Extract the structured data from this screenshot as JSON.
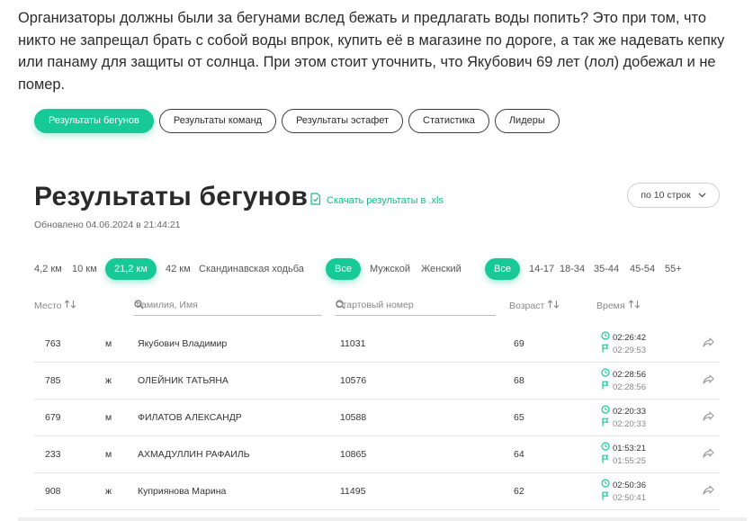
{
  "intro_text": "Организаторы должны были за бегунами вслед бежать и предлагать воды попить? Это при том, что никто не запрещал брать с собой воды впрок, купить её в магазине по дороге, а так же надевать кепку или панаму для защиты от солнца. При этом стоит уточнить, что Якубович 69 лет (лол) добежал и не помер.",
  "tabs": [
    {
      "label": "Результаты бегунов",
      "active": true
    },
    {
      "label": "Результаты команд",
      "active": false
    },
    {
      "label": "Результаты эстафет",
      "active": false
    },
    {
      "label": "Статистика",
      "active": false
    },
    {
      "label": "Лидеры",
      "active": false
    }
  ],
  "page_title": "Результаты бегунов",
  "download_label": "Скачать результаты в .xls",
  "updated_label": "Обновлено 04.06.2024 в 21:44:21",
  "per_page": {
    "label": "по 10 строк"
  },
  "distance_filters": [
    "4,2 км",
    "10 км",
    "21,2 км",
    "42 км",
    "Скандинавская ходьба"
  ],
  "distance_selected": "21,2 км",
  "gender_filters": [
    "Все",
    "Мужской",
    "Женский"
  ],
  "gender_selected": "Все",
  "age_filters": [
    "Все",
    "14-17",
    "18-34",
    "35-44",
    "45-54",
    "55+"
  ],
  "age_selected": "Все",
  "columns": {
    "place": "Место",
    "name_placeholder": "Фамилия, Имя",
    "number_placeholder": "Стартовый номер",
    "age": "Возраст",
    "time": "Время"
  },
  "rows": [
    {
      "place": "763",
      "gender": "м",
      "name": "Якубович Владимир",
      "number": "11031",
      "age": "69",
      "chip_time": "02:26:42",
      "finish_time": "02:29:53"
    },
    {
      "place": "785",
      "gender": "ж",
      "name": "ОЛЕЙНИК ТАТЬЯНА",
      "number": "10576",
      "age": "68",
      "chip_time": "02:28:56",
      "finish_time": "02:28:56"
    },
    {
      "place": "679",
      "gender": "м",
      "name": "ФИЛАТОВ АЛЕКСАНДР",
      "number": "10588",
      "age": "65",
      "chip_time": "02:20:33",
      "finish_time": "02:20:33"
    },
    {
      "place": "233",
      "gender": "м",
      "name": "АХМАДУЛЛИН РАФАИЛЬ",
      "number": "10865",
      "age": "64",
      "chip_time": "01:53:21",
      "finish_time": "01:55:25"
    },
    {
      "place": "908",
      "gender": "ж",
      "name": "Куприянова Марина",
      "number": "11495",
      "age": "62",
      "chip_time": "02:50:36",
      "finish_time": "02:50:41"
    }
  ],
  "colors": {
    "accent": "#17c996",
    "accent_text": "#17b98a",
    "text": "#2a2a2a",
    "muted": "#888888"
  }
}
